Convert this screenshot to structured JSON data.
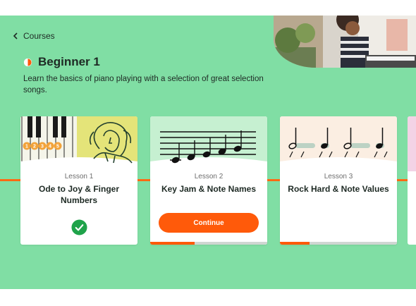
{
  "nav": {
    "back_label": "Courses",
    "back_icon": "chevron-left-icon"
  },
  "course": {
    "title": "Beginner 1",
    "description": "Learn the basics of piano playing with a selection of great selection songs.",
    "accent": "#ff5a0a",
    "background": "#80dea4"
  },
  "lessons": [
    {
      "number": "Lesson 1",
      "title": "Ode to Joy & Finger Numbers",
      "status": "completed",
      "progress": 0
    },
    {
      "number": "Lesson 2",
      "title": "Key Jam & Note Names",
      "status": "current",
      "button_label": "Continue",
      "progress": 0.38
    },
    {
      "number": "Lesson 3",
      "title": "Rock Hard & Note Values",
      "status": "locked",
      "progress": 0.25
    }
  ],
  "finger_numbers": [
    "1",
    "2",
    "3",
    "4",
    "5"
  ]
}
